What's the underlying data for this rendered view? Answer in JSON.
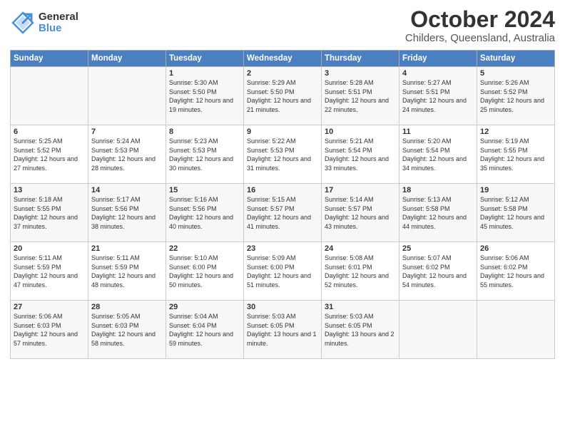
{
  "logo": {
    "general": "General",
    "blue": "Blue"
  },
  "header": {
    "month": "October 2024",
    "location": "Childers, Queensland, Australia"
  },
  "weekdays": [
    "Sunday",
    "Monday",
    "Tuesday",
    "Wednesday",
    "Thursday",
    "Friday",
    "Saturday"
  ],
  "weeks": [
    [
      {
        "day": "",
        "info": ""
      },
      {
        "day": "",
        "info": ""
      },
      {
        "day": "1",
        "info": "Sunrise: 5:30 AM\nSunset: 5:50 PM\nDaylight: 12 hours\nand 19 minutes."
      },
      {
        "day": "2",
        "info": "Sunrise: 5:29 AM\nSunset: 5:50 PM\nDaylight: 12 hours\nand 21 minutes."
      },
      {
        "day": "3",
        "info": "Sunrise: 5:28 AM\nSunset: 5:51 PM\nDaylight: 12 hours\nand 22 minutes."
      },
      {
        "day": "4",
        "info": "Sunrise: 5:27 AM\nSunset: 5:51 PM\nDaylight: 12 hours\nand 24 minutes."
      },
      {
        "day": "5",
        "info": "Sunrise: 5:26 AM\nSunset: 5:52 PM\nDaylight: 12 hours\nand 25 minutes."
      }
    ],
    [
      {
        "day": "6",
        "info": "Sunrise: 5:25 AM\nSunset: 5:52 PM\nDaylight: 12 hours\nand 27 minutes."
      },
      {
        "day": "7",
        "info": "Sunrise: 5:24 AM\nSunset: 5:53 PM\nDaylight: 12 hours\nand 28 minutes."
      },
      {
        "day": "8",
        "info": "Sunrise: 5:23 AM\nSunset: 5:53 PM\nDaylight: 12 hours\nand 30 minutes."
      },
      {
        "day": "9",
        "info": "Sunrise: 5:22 AM\nSunset: 5:53 PM\nDaylight: 12 hours\nand 31 minutes."
      },
      {
        "day": "10",
        "info": "Sunrise: 5:21 AM\nSunset: 5:54 PM\nDaylight: 12 hours\nand 33 minutes."
      },
      {
        "day": "11",
        "info": "Sunrise: 5:20 AM\nSunset: 5:54 PM\nDaylight: 12 hours\nand 34 minutes."
      },
      {
        "day": "12",
        "info": "Sunrise: 5:19 AM\nSunset: 5:55 PM\nDaylight: 12 hours\nand 35 minutes."
      }
    ],
    [
      {
        "day": "13",
        "info": "Sunrise: 5:18 AM\nSunset: 5:55 PM\nDaylight: 12 hours\nand 37 minutes."
      },
      {
        "day": "14",
        "info": "Sunrise: 5:17 AM\nSunset: 5:56 PM\nDaylight: 12 hours\nand 38 minutes."
      },
      {
        "day": "15",
        "info": "Sunrise: 5:16 AM\nSunset: 5:56 PM\nDaylight: 12 hours\nand 40 minutes."
      },
      {
        "day": "16",
        "info": "Sunrise: 5:15 AM\nSunset: 5:57 PM\nDaylight: 12 hours\nand 41 minutes."
      },
      {
        "day": "17",
        "info": "Sunrise: 5:14 AM\nSunset: 5:57 PM\nDaylight: 12 hours\nand 43 minutes."
      },
      {
        "day": "18",
        "info": "Sunrise: 5:13 AM\nSunset: 5:58 PM\nDaylight: 12 hours\nand 44 minutes."
      },
      {
        "day": "19",
        "info": "Sunrise: 5:12 AM\nSunset: 5:58 PM\nDaylight: 12 hours\nand 45 minutes."
      }
    ],
    [
      {
        "day": "20",
        "info": "Sunrise: 5:11 AM\nSunset: 5:59 PM\nDaylight: 12 hours\nand 47 minutes."
      },
      {
        "day": "21",
        "info": "Sunrise: 5:11 AM\nSunset: 5:59 PM\nDaylight: 12 hours\nand 48 minutes."
      },
      {
        "day": "22",
        "info": "Sunrise: 5:10 AM\nSunset: 6:00 PM\nDaylight: 12 hours\nand 50 minutes."
      },
      {
        "day": "23",
        "info": "Sunrise: 5:09 AM\nSunset: 6:00 PM\nDaylight: 12 hours\nand 51 minutes."
      },
      {
        "day": "24",
        "info": "Sunrise: 5:08 AM\nSunset: 6:01 PM\nDaylight: 12 hours\nand 52 minutes."
      },
      {
        "day": "25",
        "info": "Sunrise: 5:07 AM\nSunset: 6:02 PM\nDaylight: 12 hours\nand 54 minutes."
      },
      {
        "day": "26",
        "info": "Sunrise: 5:06 AM\nSunset: 6:02 PM\nDaylight: 12 hours\nand 55 minutes."
      }
    ],
    [
      {
        "day": "27",
        "info": "Sunrise: 5:06 AM\nSunset: 6:03 PM\nDaylight: 12 hours\nand 57 minutes."
      },
      {
        "day": "28",
        "info": "Sunrise: 5:05 AM\nSunset: 6:03 PM\nDaylight: 12 hours\nand 58 minutes."
      },
      {
        "day": "29",
        "info": "Sunrise: 5:04 AM\nSunset: 6:04 PM\nDaylight: 12 hours\nand 59 minutes."
      },
      {
        "day": "30",
        "info": "Sunrise: 5:03 AM\nSunset: 6:05 PM\nDaylight: 13 hours\nand 1 minute."
      },
      {
        "day": "31",
        "info": "Sunrise: 5:03 AM\nSunset: 6:05 PM\nDaylight: 13 hours\nand 2 minutes."
      },
      {
        "day": "",
        "info": ""
      },
      {
        "day": "",
        "info": ""
      }
    ]
  ]
}
